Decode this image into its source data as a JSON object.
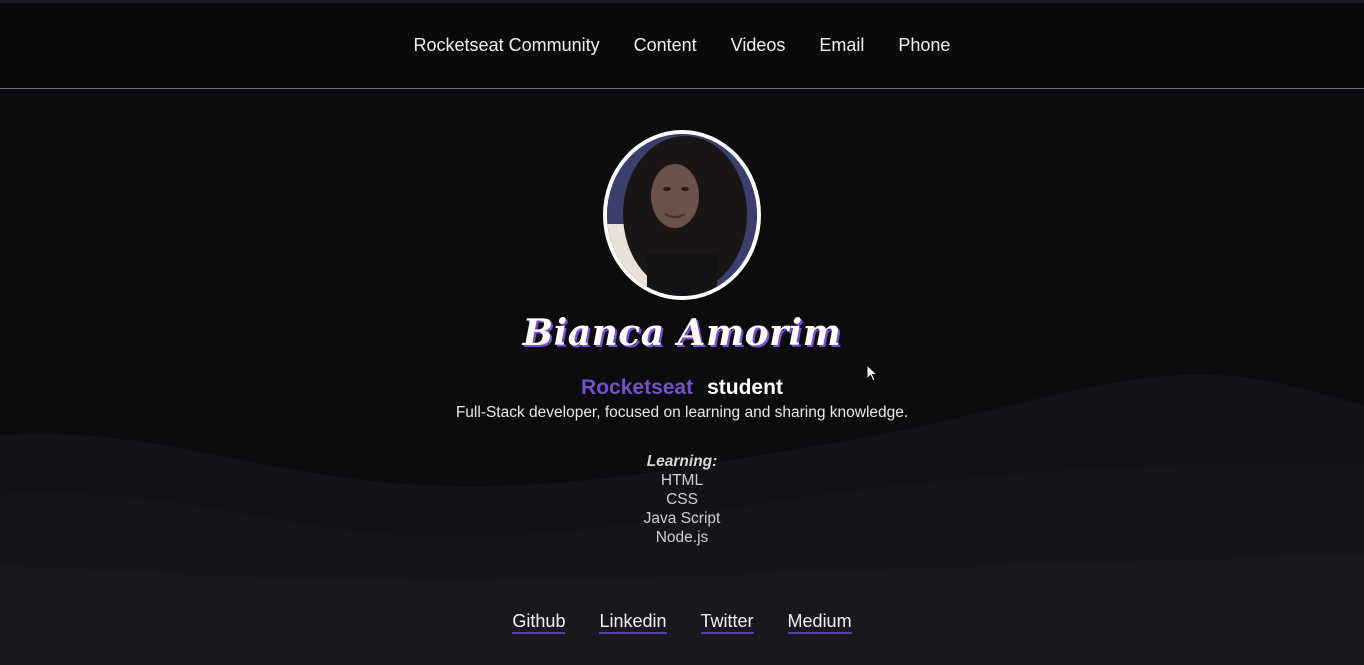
{
  "nav": {
    "items": [
      {
        "label": "Rocketseat Community"
      },
      {
        "label": "Content"
      },
      {
        "label": "Videos"
      },
      {
        "label": "Email"
      },
      {
        "label": "Phone"
      }
    ]
  },
  "profile": {
    "name": "Bianca Amorim",
    "role_brand": "Rocketseat",
    "role_tail": "student",
    "bio": "Full-Stack developer, focused on learning and sharing knowledge.",
    "learning_title": "Learning:",
    "learning_items": [
      "HTML",
      "CSS",
      "Java Script",
      "Node.js"
    ]
  },
  "social": {
    "links": [
      {
        "label": "Github"
      },
      {
        "label": "Linkedin"
      },
      {
        "label": "Twitter"
      },
      {
        "label": "Medium"
      }
    ]
  },
  "colors": {
    "background": "#0c0c0f",
    "accent": "#7451c8",
    "link_underline": "#5b3fb0",
    "text": "#ffffff"
  }
}
